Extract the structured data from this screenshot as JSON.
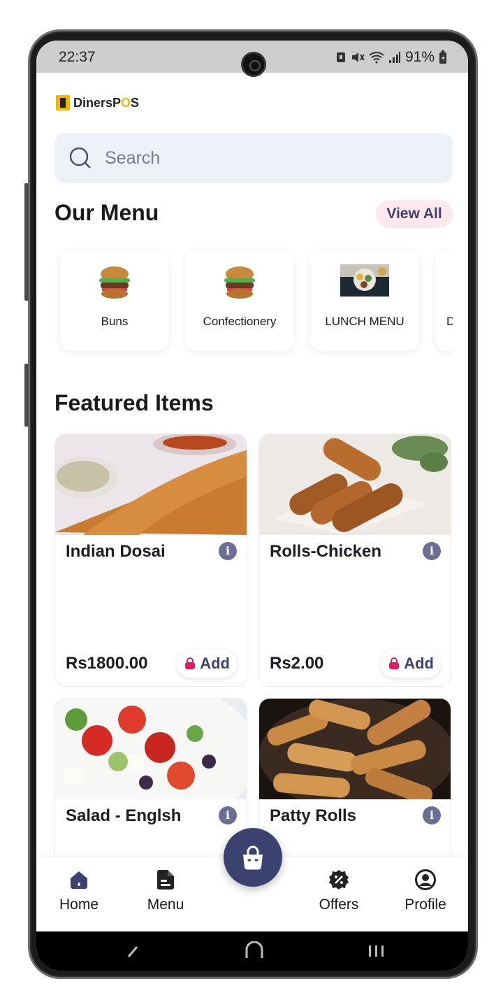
{
  "status_bar": {
    "time": "22:37",
    "battery": "91%"
  },
  "app": {
    "logo_text_a": "DinersP",
    "logo_text_o": "O",
    "logo_text_b": "S"
  },
  "search": {
    "placeholder": "Search"
  },
  "menu_section": {
    "title": "Our Menu",
    "view_all": "View All",
    "categories": [
      {
        "label": "Buns"
      },
      {
        "label": "Confectionery"
      },
      {
        "label": "LUNCH MENU"
      },
      {
        "label": "D"
      }
    ]
  },
  "featured": {
    "title": "Featured Items",
    "add_label": "Add",
    "items": [
      {
        "name": "Indian Dosai",
        "price": "Rs1800.00"
      },
      {
        "name": "Rolls-Chicken",
        "price": "Rs2.00"
      },
      {
        "name": "Salad - Englsh",
        "price": ""
      },
      {
        "name": "Patty Rolls",
        "price": ""
      }
    ]
  },
  "bottom_nav": {
    "items": [
      {
        "label": "Home"
      },
      {
        "label": "Menu"
      },
      {
        "label": "Offers"
      },
      {
        "label": "Profile"
      }
    ]
  },
  "colors": {
    "primary": "#3b4270",
    "accent_pink": "#e6195e",
    "brand_yellow": "#f5b400"
  },
  "icons": [
    "search-icon",
    "info-icon",
    "bag-icon",
    "home-icon",
    "menu-icon",
    "offers-icon",
    "profile-icon"
  ]
}
